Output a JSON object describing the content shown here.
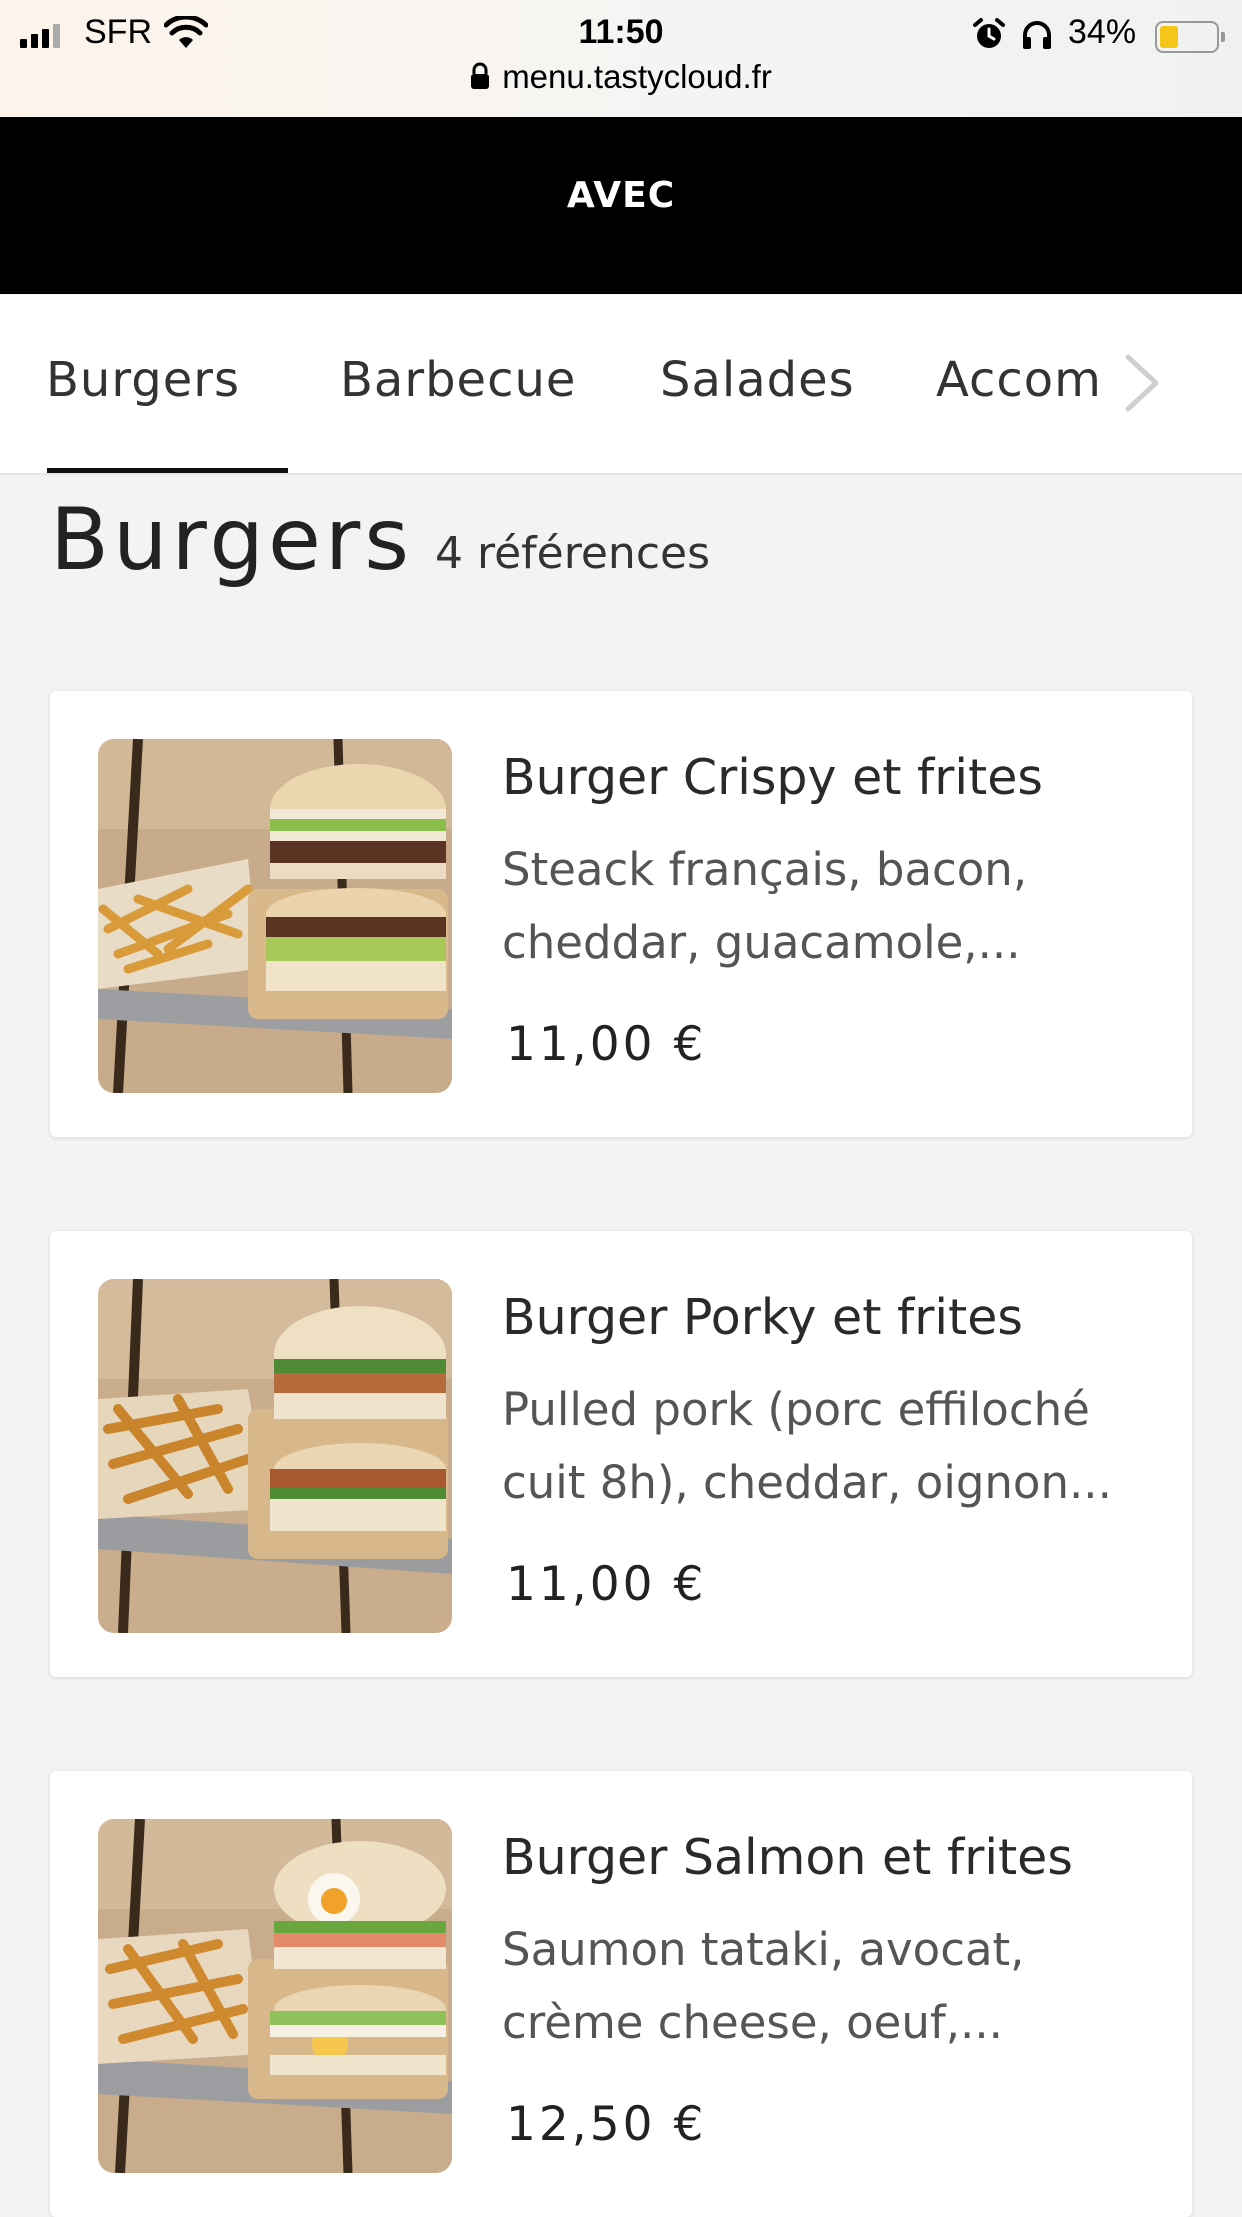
{
  "status": {
    "carrier": "SFR",
    "time": "11:50",
    "battery_pct": "34%",
    "battery_level": 0.34,
    "url": "menu.tastycloud.fr"
  },
  "header": {
    "brand": "AVEC"
  },
  "tabs": [
    {
      "label": "Burgers"
    },
    {
      "label": "Barbecue"
    },
    {
      "label": "Salades"
    },
    {
      "label": "Accom"
    }
  ],
  "section": {
    "title": "Burgers",
    "count": "4 références"
  },
  "products": [
    {
      "name": "Burger Crispy et frites",
      "desc_line1": "Steack français, bacon,",
      "desc_line2": "cheddar, guacamole,...",
      "price": "11,00 €"
    },
    {
      "name": "Burger Porky et frites",
      "desc_line1": "Pulled pork (porc effiloché",
      "desc_line2": "cuit 8h), cheddar, oignon...",
      "price": "11,00 €"
    },
    {
      "name": "Burger Salmon et frites",
      "desc_line1": "Saumon tataki, avocat,",
      "desc_line2": "crème cheese, oeuf,...",
      "price": "12,50 €"
    }
  ],
  "colors": {
    "header_bg": "#000000",
    "page_bg": "#f3f3f3",
    "card_bg": "#ffffff",
    "battery_fill": "#f5c518"
  }
}
